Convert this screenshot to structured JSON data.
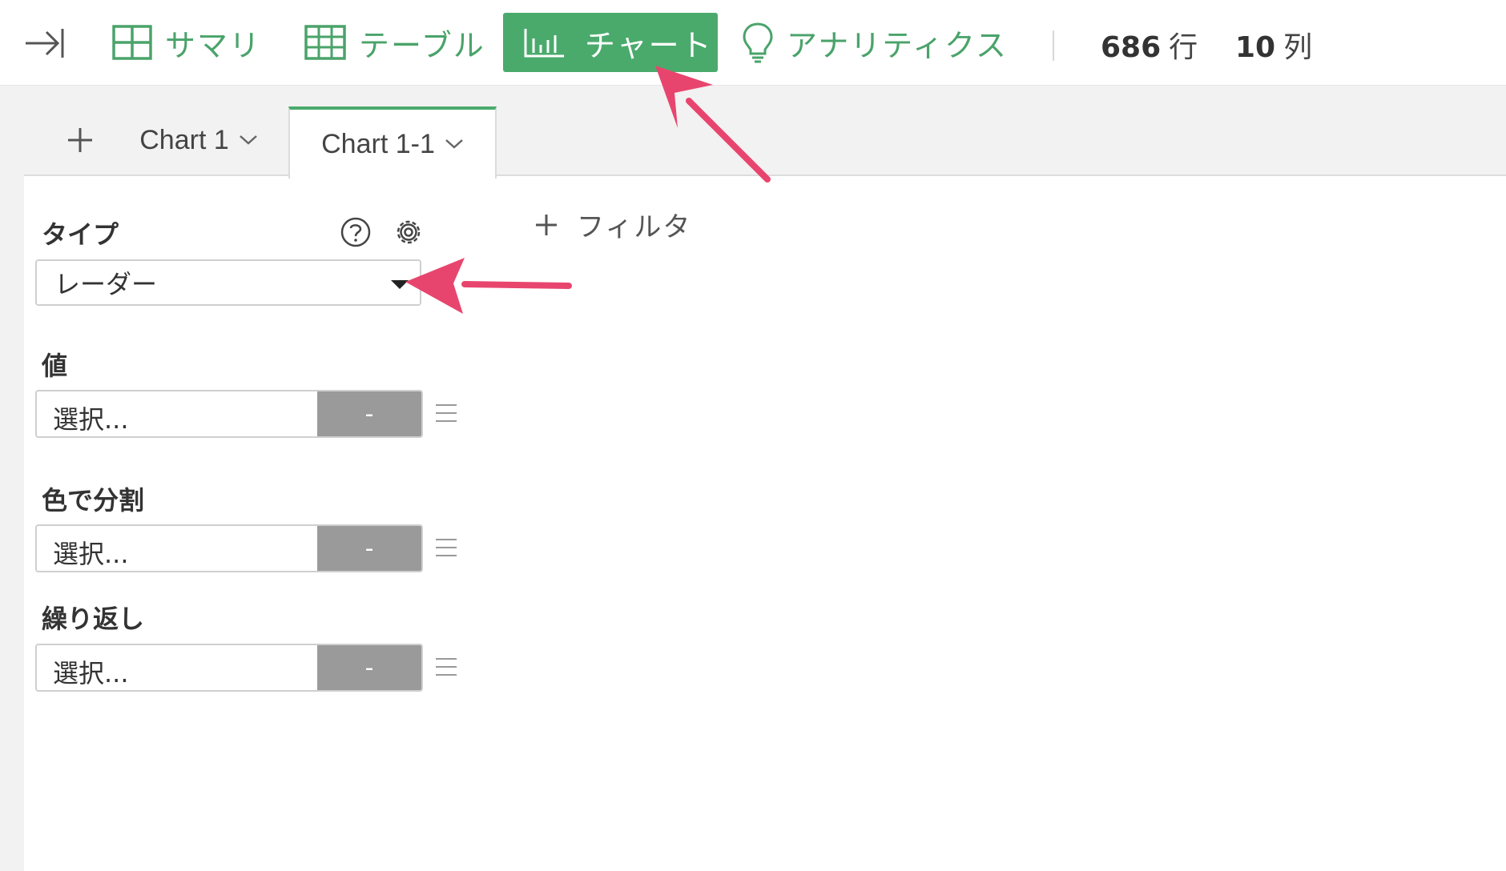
{
  "toolbar": {
    "nav": [
      {
        "label": "サマリ",
        "icon": "summary-grid-icon",
        "active": false
      },
      {
        "label": "テーブル",
        "icon": "table-icon",
        "active": false
      },
      {
        "label": "チャート",
        "icon": "bar-chart-icon",
        "active": true
      },
      {
        "label": "アナリティクス",
        "icon": "lightbulb-icon",
        "active": false
      }
    ],
    "rows": {
      "value": "686",
      "unit": "行"
    },
    "cols": {
      "value": "10",
      "unit": "列"
    }
  },
  "tabs": [
    {
      "label": "Chart 1",
      "active": false
    },
    {
      "label": "Chart 1-1",
      "active": true
    }
  ],
  "config": {
    "type_label": "タイプ",
    "type_value": "レーダー",
    "filter_label": "フィルタ",
    "fields": [
      {
        "label": "値",
        "placeholder": "選択...",
        "agg": "-"
      },
      {
        "label": "色で分割",
        "placeholder": "選択...",
        "agg": "-"
      },
      {
        "label": "繰り返し",
        "placeholder": "選択...",
        "agg": "-"
      }
    ]
  },
  "colors": {
    "accent": "#4aaa6c",
    "annotation_arrow": "#e8456e"
  }
}
